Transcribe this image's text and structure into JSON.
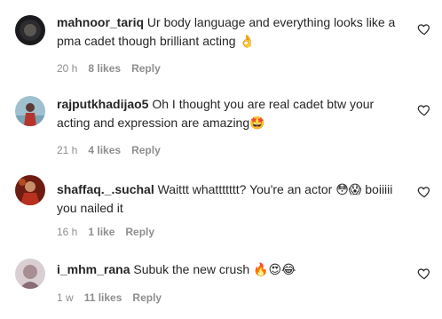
{
  "comments": [
    {
      "username": "mahnoor_tariq",
      "text": "Ur body language and everything looks like a pma cadet though brilliant acting 👌",
      "time": "20 h",
      "likes": "8 likes",
      "reply": "Reply"
    },
    {
      "username": "rajputkhadijao5",
      "text": "Oh I thought you are real cadet btw your acting and expression are amazing🤩",
      "time": "21 h",
      "likes": "4 likes",
      "reply": "Reply"
    },
    {
      "username": "shaffaq._.suchal",
      "text": "Waittt whattttttt? You're an actor 😳😱 boiiiii you nailed it",
      "time": "16 h",
      "likes": "1 like",
      "reply": "Reply"
    },
    {
      "username": "i_mhm_rana",
      "text": "Subuk the new crush 🔥😍😂",
      "time": "1 w",
      "likes": "11 likes",
      "reply": "Reply"
    }
  ],
  "icons": {
    "like": "heart-outline-icon"
  },
  "colors": {
    "text": "#262626",
    "meta": "#8e8e8e"
  }
}
